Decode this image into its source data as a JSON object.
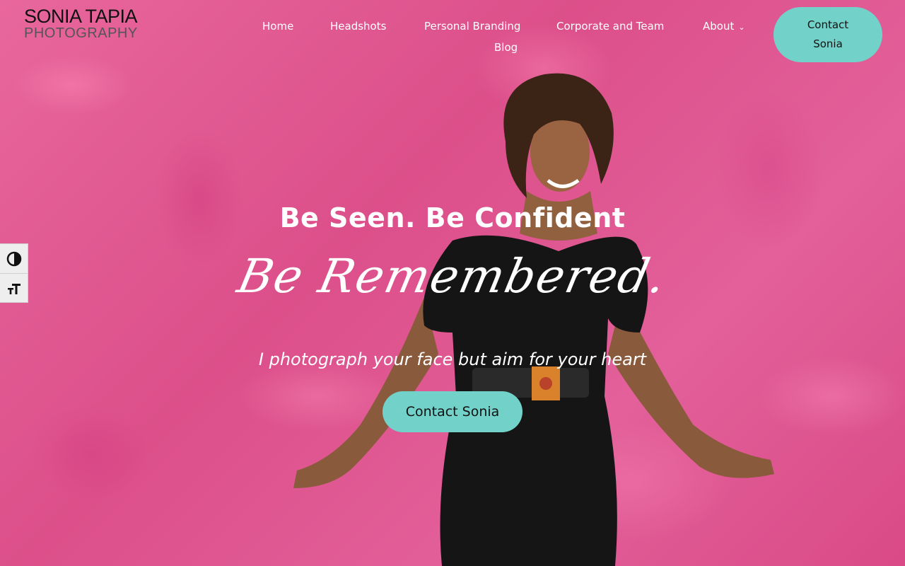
{
  "logo": {
    "line1": "SONIA TAPIA",
    "line2": "PHOTOGRAPHY"
  },
  "nav": {
    "items": [
      {
        "label": "Home"
      },
      {
        "label": "Headshots"
      },
      {
        "label": "Personal Branding"
      },
      {
        "label": "Corporate and Team"
      },
      {
        "label": "About",
        "icon": "chevron-down-icon"
      },
      {
        "label": "Blog"
      }
    ],
    "contact_button": "Contact Sonia"
  },
  "accessibility": {
    "items": [
      {
        "icon": "contrast-toggle-icon"
      },
      {
        "icon": "font-size-icon"
      }
    ]
  },
  "hero": {
    "headline": "Be Seen. Be Confident",
    "script_line": "Be Remembered.",
    "subline": "I photograph your face but aim for your heart",
    "cta_label": "Contact Sonia"
  },
  "colors": {
    "background_pink": "#e0588f",
    "accent_teal": "#72d2c9",
    "text_white": "#ffffff",
    "logo_dark": "#111111",
    "logo_gray": "#555555"
  }
}
